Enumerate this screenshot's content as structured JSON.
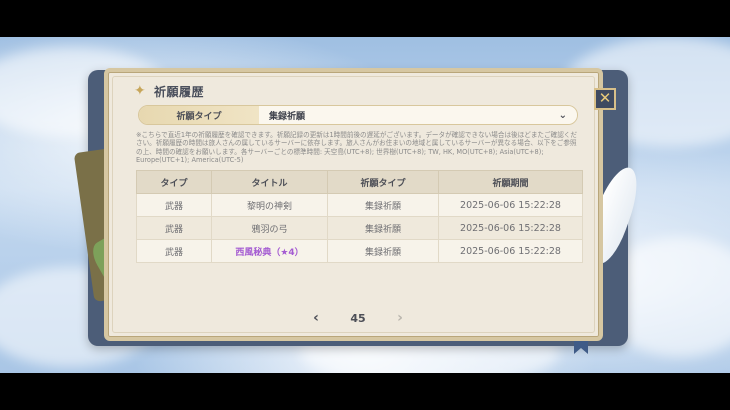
{
  "panel": {
    "title": "祈願履歴",
    "title_icon": "sparkle-icon",
    "close_label": "✕"
  },
  "type_selector": {
    "label": "祈願タイプ",
    "selected": "集録祈願",
    "chevron": "⌄"
  },
  "notice": "※こちらで直近1年の祈願履歴を確認できます。祈願記録の更新は1時間前後の遅延がございます。データが確認できない場合は後ほどまたご確認ください。祈願履歴の時間は旅人さんの属しているサーバーに依存します。旅人さんがお住まいの地域と属しているサーバーが異なる場合、以下をご参照の上、時間の確認をお願いします。各サーバーごとの標準時間: 天空島(UTC+8); 世界樹(UTC+8); TW, HK, MO(UTC+8); Asia(UTC+8); Europe(UTC+1); America(UTC-5)",
  "table": {
    "headers": [
      "タイプ",
      "タイトル",
      "祈願タイプ",
      "祈願期間"
    ],
    "rows": [
      {
        "type": "武器",
        "title": "黎明の神剣",
        "wish_type": "集録祈願",
        "time": "2025-06-06 15:22:28",
        "rarity": "3"
      },
      {
        "type": "武器",
        "title": "鴉羽の弓",
        "wish_type": "集録祈願",
        "time": "2025-06-06 15:22:28",
        "rarity": "3"
      },
      {
        "type": "武器",
        "title": "西風秘典（★4）",
        "wish_type": "集録祈願",
        "time": "2025-06-06 15:22:28",
        "rarity": "4"
      }
    ]
  },
  "pager": {
    "prev": "‹",
    "page": "45",
    "next": "›"
  },
  "colors": {
    "rarity4": "#a45bd2",
    "panel_bg": "#efe9dd",
    "accent_gold": "#d6c7a2"
  }
}
